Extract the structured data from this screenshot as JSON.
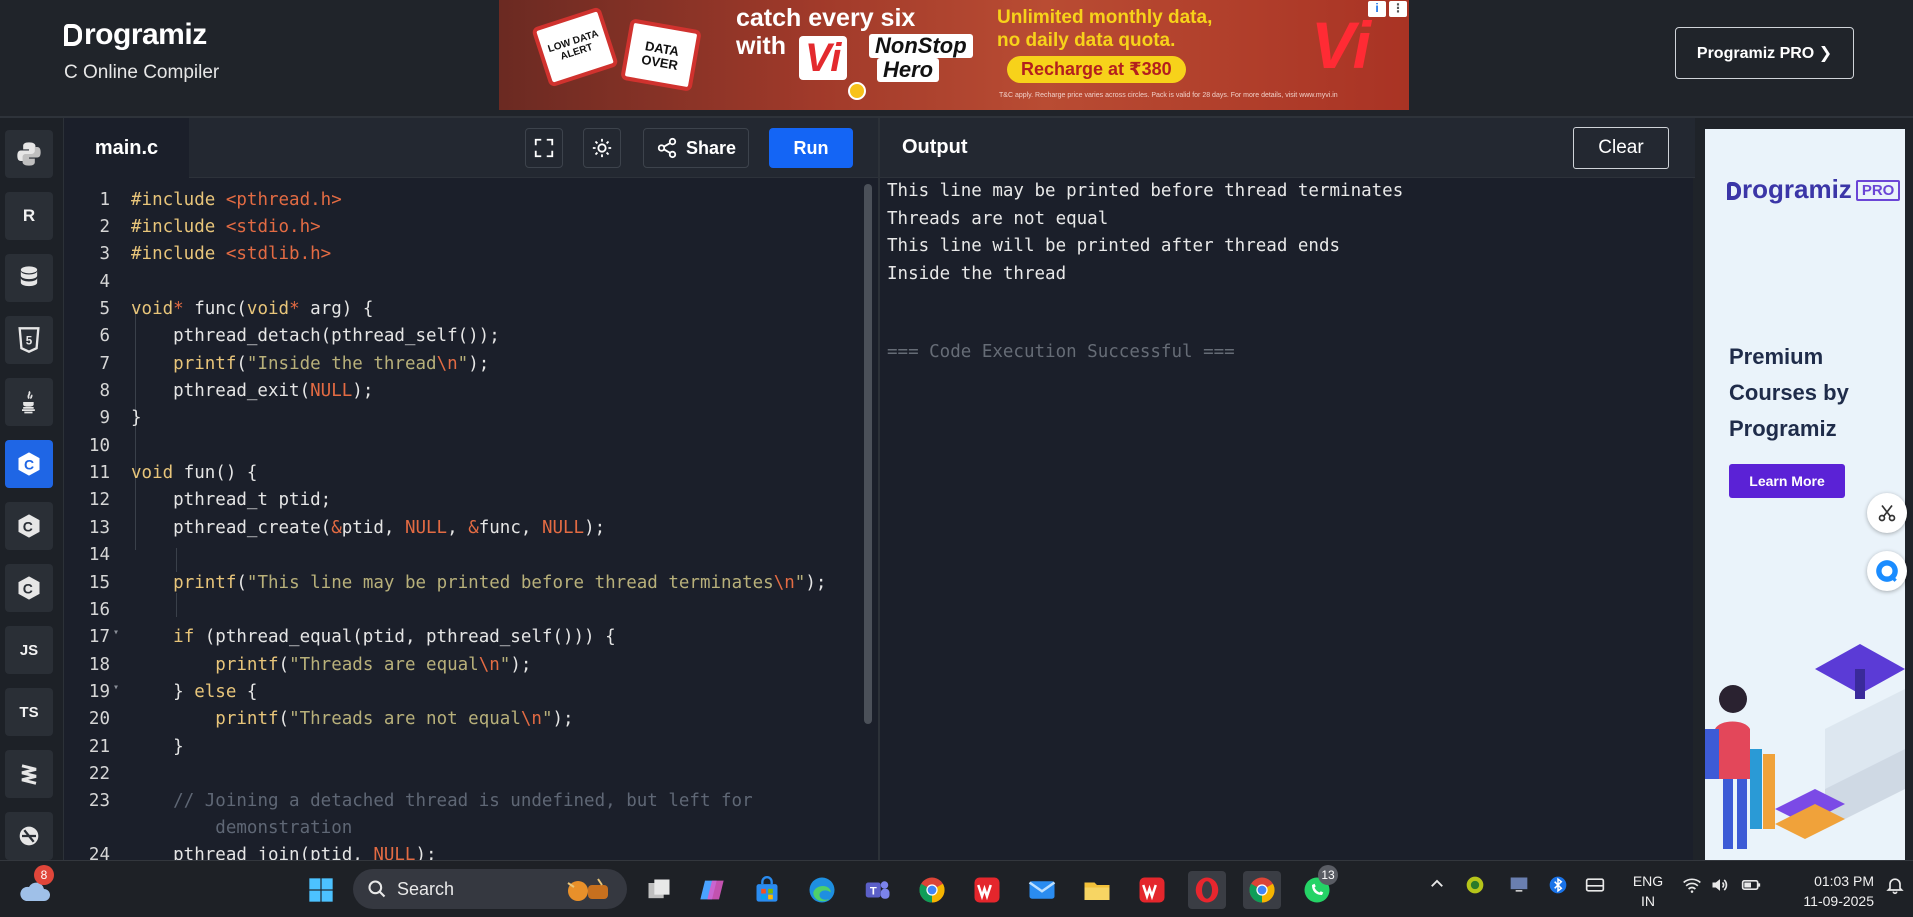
{
  "header": {
    "brand": "rogramiz",
    "subtitle": "C Online Compiler",
    "pro_button": "Programiz PRO ❯"
  },
  "ad_banner": {
    "card1": "LOW DATA ALERT",
    "card2": "DATA OVER",
    "headline1": "catch every six",
    "headline2": "with",
    "brand_short": "Vi",
    "nonstop": "NonStop",
    "hero": "Hero",
    "offer1": "Unlimited monthly data,",
    "offer2": "no daily data quota.",
    "recharge": "Recharge at ₹380",
    "fine_print": "T&C apply. Recharge price varies across circles. Pack is valid for 28 days. For more details, visit www.myvi.in",
    "logo": "Vi",
    "info": "i",
    "more": "⋮"
  },
  "rail": {
    "items": [
      {
        "name": "python",
        "label": ""
      },
      {
        "name": "r",
        "label": "R"
      },
      {
        "name": "sql",
        "label": ""
      },
      {
        "name": "html",
        "label": "5"
      },
      {
        "name": "java",
        "label": ""
      },
      {
        "name": "c",
        "label": "C"
      },
      {
        "name": "cpp",
        "label": "C"
      },
      {
        "name": "csharp",
        "label": "C"
      },
      {
        "name": "js",
        "label": "JS"
      },
      {
        "name": "ts",
        "label": "TS"
      },
      {
        "name": "swift",
        "label": ""
      },
      {
        "name": "go",
        "label": ""
      }
    ]
  },
  "editor": {
    "file_tab": "main.c",
    "share_label": "Share",
    "run_label": "Run",
    "lines": [
      {
        "n": "1",
        "html": "<span class='inc'>#include</span> <span class='hdr'>&lt;pthread.h&gt;</span>"
      },
      {
        "n": "2",
        "html": "<span class='inc'>#include</span> <span class='hdr'>&lt;stdio.h&gt;</span>"
      },
      {
        "n": "3",
        "html": "<span class='inc'>#include</span> <span class='hdr'>&lt;stdlib.h&gt;</span>"
      },
      {
        "n": "4",
        "html": ""
      },
      {
        "n": "5",
        "html": "<span class='kw'>void</span><span class='amp'>*</span> func(<span class='kw'>void</span><span class='amp'>*</span> arg) {"
      },
      {
        "n": "6",
        "html": "    pthread_detach(pthread_self());"
      },
      {
        "n": "7",
        "html": "    <span class='fn'>printf</span>(<span class='str'>\"Inside the thread</span><span class='esc'>\\n</span><span class='str'>\"</span>);"
      },
      {
        "n": "8",
        "html": "    pthread_exit(<span class='nul'>NULL</span>);"
      },
      {
        "n": "9",
        "html": "}"
      },
      {
        "n": "10",
        "html": ""
      },
      {
        "n": "11",
        "html": "<span class='kw'>void</span> fun() {"
      },
      {
        "n": "12",
        "html": "    pthread_t ptid;"
      },
      {
        "n": "13",
        "html": "    pthread_create(<span class='amp'>&amp;</span>ptid, <span class='nul'>NULL</span>, <span class='amp'>&amp;</span>func, <span class='nul'>NULL</span>);"
      },
      {
        "n": "14",
        "html": ""
      },
      {
        "n": "15",
        "html": "    <span class='fn'>printf</span>(<span class='str'>\"This line may be printed before thread terminates</span><span class='esc'>\\n</span><span class='str'>\"</span>);"
      },
      {
        "n": "16",
        "html": ""
      },
      {
        "n": "17",
        "html": "    <span class='kw'>if</span> (pthread_equal(ptid, pthread_self())) {"
      },
      {
        "n": "18",
        "html": "        <span class='fn'>printf</span>(<span class='str'>\"Threads are equal</span><span class='esc'>\\n</span><span class='str'>\"</span>);"
      },
      {
        "n": "19",
        "html": "    } <span class='kw'>else</span> {"
      },
      {
        "n": "20",
        "html": "        <span class='fn'>printf</span>(<span class='str'>\"Threads are not equal</span><span class='esc'>\\n</span><span class='str'>\"</span>);"
      },
      {
        "n": "21",
        "html": "    }"
      },
      {
        "n": "22",
        "html": ""
      },
      {
        "n": "23",
        "html": "    <span class='cm'>// Joining a detached thread is undefined, but left for</span>"
      },
      {
        "n": "",
        "html": "        <span class='cm'>demonstration</span>"
      },
      {
        "n": "24",
        "html": "    pthread_join(ptid, <span class='nul'>NULL</span>);"
      }
    ]
  },
  "output": {
    "title": "Output",
    "clear_label": "Clear",
    "lines": [
      "This line may be printed before thread terminates",
      "Threads are not equal",
      "This line will be printed after thread ends",
      "Inside the thread"
    ],
    "status": "=== Code Execution Successful ==="
  },
  "side_ad": {
    "logo": "rogramiz",
    "pro": "PRO",
    "heading": "Premium Courses by Programiz",
    "cta": "Learn More"
  },
  "taskbar": {
    "weather_badge": "8",
    "search_label": "Search",
    "whatsapp_badge": "13",
    "lang_line1": "ENG",
    "lang_line2": "IN",
    "time": "01:03 PM",
    "date": "11-09-2025"
  },
  "colors": {
    "accent": "#1465f5",
    "panel": "#1b1f2a",
    "header": "#20242a",
    "pro_purple": "#5b22d6"
  }
}
